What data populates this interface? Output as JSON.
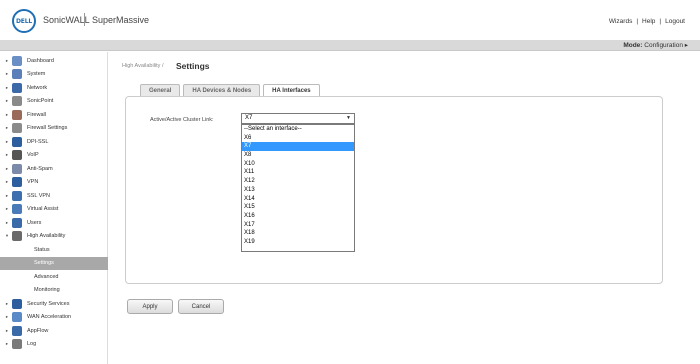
{
  "header": {
    "logo_text": "DELL",
    "brand": "SonicWALL",
    "product": "SuperMassive",
    "links": [
      "Wizards",
      "Help",
      "Logout"
    ],
    "link_separator": "|"
  },
  "modebar": {
    "mode_label": "Mode:",
    "mode_value": "Configuration ▸"
  },
  "sidebar": {
    "items": [
      {
        "label": "Dashboard",
        "icon": "dashboard-icon",
        "arrow": "▸",
        "color": "#6a8fc4"
      },
      {
        "label": "System",
        "icon": "system-icon",
        "arrow": "▸",
        "color": "#5b7fb8"
      },
      {
        "label": "Network",
        "icon": "network-icon",
        "arrow": "▸",
        "color": "#3c6aa8"
      },
      {
        "label": "SonicPoint",
        "icon": "sonicpoint-icon",
        "arrow": "▸",
        "color": "#8a8a8a"
      },
      {
        "label": "Firewall",
        "icon": "firewall-icon",
        "arrow": "▸",
        "color": "#9a6a5a"
      },
      {
        "label": "Firewall Settings",
        "icon": "firewall-settings-icon",
        "arrow": "▸",
        "color": "#8a8a8a"
      },
      {
        "label": "DPI-SSL",
        "icon": "dpi-ssl-icon",
        "arrow": "▸",
        "color": "#2d5f9e"
      },
      {
        "label": "VoIP",
        "icon": "voip-icon",
        "arrow": "▸",
        "color": "#555555"
      },
      {
        "label": "Anti-Spam",
        "icon": "anti-spam-icon",
        "arrow": "▸",
        "color": "#7a8aa8"
      },
      {
        "label": "VPN",
        "icon": "vpn-icon",
        "arrow": "▸",
        "color": "#2d5f9e"
      },
      {
        "label": "SSL VPN",
        "icon": "ssl-vpn-icon",
        "arrow": "▸",
        "color": "#3d6fae"
      },
      {
        "label": "Virtual Assist",
        "icon": "virtual-assist-icon",
        "arrow": "▸",
        "color": "#4a7ab8"
      },
      {
        "label": "Users",
        "icon": "users-icon",
        "arrow": "▸",
        "color": "#3a6aa8"
      },
      {
        "label": "High Availability",
        "icon": "high-availability-icon",
        "arrow": "▾",
        "color": "#6a6a6a"
      }
    ],
    "sub_items": [
      {
        "label": "Status",
        "active": false
      },
      {
        "label": "Settings",
        "active": true
      },
      {
        "label": "Advanced",
        "active": false
      },
      {
        "label": "Monitoring",
        "active": false
      }
    ],
    "items_after": [
      {
        "label": "Security Services",
        "icon": "security-services-icon",
        "arrow": "▸",
        "color": "#2d5f9e"
      },
      {
        "label": "WAN Acceleration",
        "icon": "wan-acceleration-icon",
        "arrow": "▸",
        "color": "#5a8ac8"
      },
      {
        "label": "AppFlow",
        "icon": "appflow-icon",
        "arrow": "▸",
        "color": "#3a6aa8"
      },
      {
        "label": "Log",
        "icon": "log-icon",
        "arrow": "▸",
        "color": "#7a7a7a"
      }
    ]
  },
  "main": {
    "breadcrumb": "High Availability /",
    "title": "Settings",
    "tabs": [
      {
        "label": "General",
        "active": false
      },
      {
        "label": "HA Devices & Nodes",
        "active": false
      },
      {
        "label": "HA Interfaces",
        "active": true
      }
    ],
    "field_label": "Active/Active Cluster Link:",
    "select_value": "X7",
    "select_caret": "▼",
    "options": [
      "--Select an interface--",
      "X6",
      "X7",
      "X8",
      "X10",
      "X11",
      "X12",
      "X13",
      "X14",
      "X15",
      "X16",
      "X17",
      "X18",
      "X19"
    ],
    "selected_option": "X7",
    "apply_label": "Apply",
    "cancel_label": "Cancel"
  }
}
